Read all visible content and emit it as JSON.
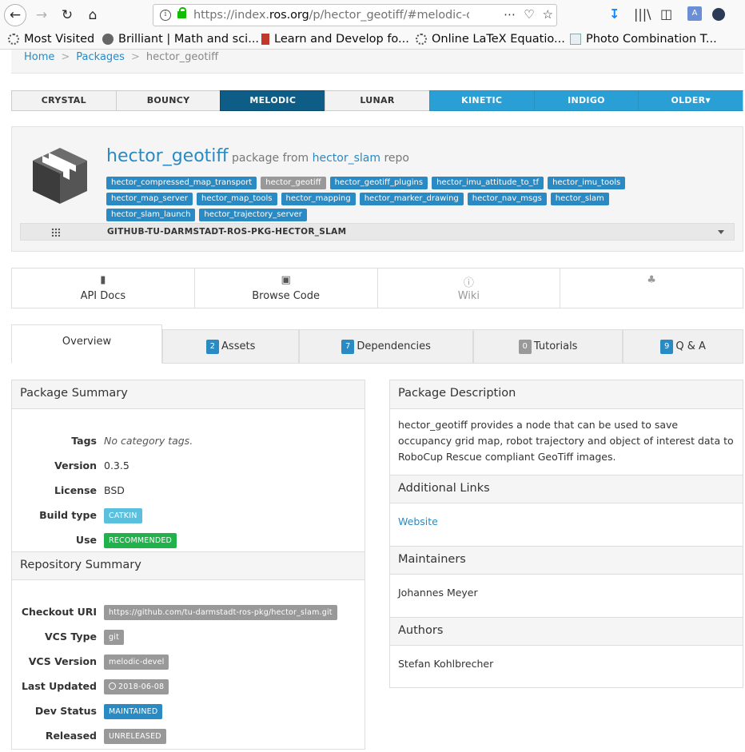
{
  "browser": {
    "url_prefix": "https://index.",
    "url_domain": "ros.org",
    "url_suffix": "/p/hector_geotiff/#melodic-c",
    "bookmarks": [
      {
        "label": "Most Visited"
      },
      {
        "label": "Brilliant | Math and sci..."
      },
      {
        "label": "Learn and Develop fo..."
      },
      {
        "label": "Online LaTeX Equatio..."
      },
      {
        "label": "Photo Combination T..."
      }
    ]
  },
  "breadcrumb": {
    "home": "Home",
    "packages": "Packages",
    "current": "hector_geotiff"
  },
  "distros": [
    "CRYSTAL",
    "BOUNCY",
    "MELODIC",
    "LUNAR",
    "KINETIC",
    "INDIGO",
    "OLDER"
  ],
  "package": {
    "name": "hector_geotiff",
    "from_text": "package from",
    "repo": "hector_slam",
    "repo_suffix": "repo",
    "tags": [
      "hector_compressed_map_transport",
      "hector_geotiff",
      "hector_geotiff_plugins",
      "hector_imu_attitude_to_tf",
      "hector_imu_tools",
      "hector_map_server",
      "hector_map_tools",
      "hector_mapping",
      "hector_marker_drawing",
      "hector_nav_msgs",
      "hector_slam",
      "hector_slam_launch",
      "hector_trajectory_server"
    ],
    "repo_bar": "GITHUB-TU-DARMSTADT-ROS-PKG-HECTOR_SLAM"
  },
  "doc_links": {
    "api": "API Docs",
    "browse": "Browse Code",
    "wiki": "Wiki"
  },
  "tabs": {
    "overview": "Overview",
    "assets_count": "2",
    "assets": "Assets",
    "deps_count": "7",
    "deps": "Dependencies",
    "tutorials_count": "0",
    "tutorials": "Tutorials",
    "qa_count": "9",
    "qa": "Q & A"
  },
  "package_summary": {
    "title": "Package Summary",
    "tags_label": "Tags",
    "tags_value": "No category tags.",
    "version_label": "Version",
    "version_value": "0.3.5",
    "license_label": "License",
    "license_value": "BSD",
    "build_label": "Build type",
    "build_value": "CATKIN",
    "use_label": "Use",
    "use_value": "RECOMMENDED"
  },
  "repo_summary": {
    "title": "Repository Summary",
    "checkout_label": "Checkout URI",
    "checkout_value": "https://github.com/tu-darmstadt-ros-pkg/hector_slam.git",
    "vcs_type_label": "VCS Type",
    "vcs_type_value": "git",
    "vcs_version_label": "VCS Version",
    "vcs_version_value": "melodic-devel",
    "updated_label": "Last Updated",
    "updated_value": "2018-06-08",
    "dev_status_label": "Dev Status",
    "dev_status_value": "MAINTAINED",
    "released_label": "Released",
    "released_value": "UNRELEASED"
  },
  "description": {
    "title": "Package Description",
    "text": "hector_geotiff provides a node that can be used to save occupancy grid map, robot trajectory and object of interest data to RoboCup Rescue compliant GeoTiff images.",
    "links_title": "Additional Links",
    "website": "Website",
    "maintainers_title": "Maintainers",
    "maintainer": "Johannes Meyer",
    "authors_title": "Authors",
    "author": "Stefan Kohlbrecher"
  }
}
